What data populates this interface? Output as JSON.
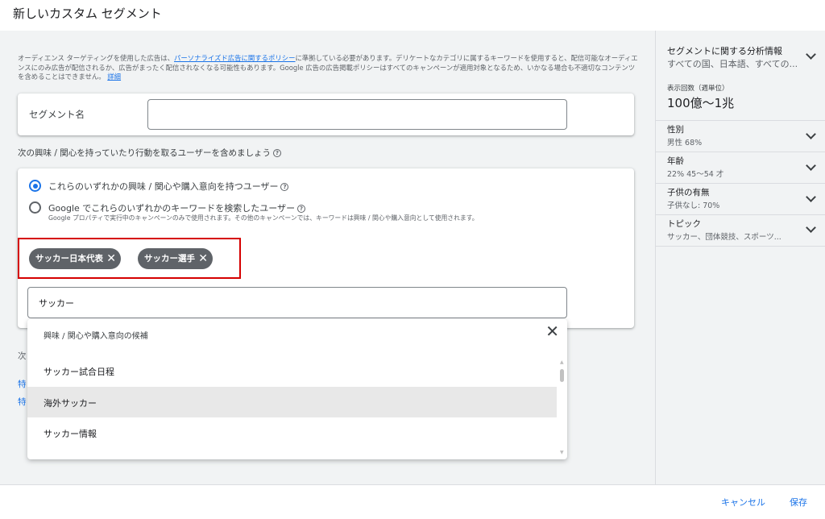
{
  "header": {
    "title": "新しいカスタム セグメント"
  },
  "notice": {
    "prefix": "オーディエンス ターゲティングを使用した広告は、",
    "policy_link": "パーソナライズド広告に関するポリシー",
    "body": "に準拠している必要があります。デリケートなカテゴリに属するキーワードを使用すると、配信可能なオーディエンスにのみ広告が配信されるか、広告がまったく配信されなくなる可能性もあります。Google 広告の広告掲載ポリシーはすべてのキャンペーンが適用対象となるため、いかなる場合も不適切なコンテンツを含めることはできません。",
    "detail_link": "詳細"
  },
  "segment_name": {
    "label": "セグメント名",
    "value": ""
  },
  "include": {
    "title": "次の興味 / 関心を持っていたり行動を取るユーザーを含めましょう",
    "options": [
      {
        "label": "これらのいずれかの興味 / 関心や購入意向を持つユーザー",
        "selected": true
      },
      {
        "label": "Google でこれらのいずれかのキーワードを検索したユーザー",
        "selected": false,
        "sub": "Google プロパティで実行中のキャンペーンのみで使用されます。その他のキャンペーンでは、キーワードは興味 / 関心や購入意向として使用されます。"
      }
    ],
    "chips": [
      "サッカー日本代表",
      "サッカー選手"
    ],
    "keyword_value": "サッカー"
  },
  "background": {
    "partial_text": "次",
    "link1": "特",
    "link2": "特"
  },
  "dropdown": {
    "header": "興味 / 関心や購入意向の候補",
    "items": [
      "サッカー試合日程",
      "海外サッカー",
      "サッカー情報"
    ],
    "highlighted_index": 1
  },
  "sidebar": {
    "insights_title": "セグメントに関する分析情報",
    "insights_sub": "すべての国、日本語、すべての...",
    "impressions_label": "表示回数（週単位）",
    "impressions_value": "100億〜1兆",
    "sections": [
      {
        "title": "性別",
        "value": "男性 68%"
      },
      {
        "title": "年齢",
        "value": "22% 45〜54 才"
      },
      {
        "title": "子供の有無",
        "value": "子供なし: 70%"
      },
      {
        "title": "トピック",
        "value": "サッカー、団体競技、スポーツ..."
      }
    ]
  },
  "footer": {
    "cancel": "キャンセル",
    "save": "保存"
  }
}
